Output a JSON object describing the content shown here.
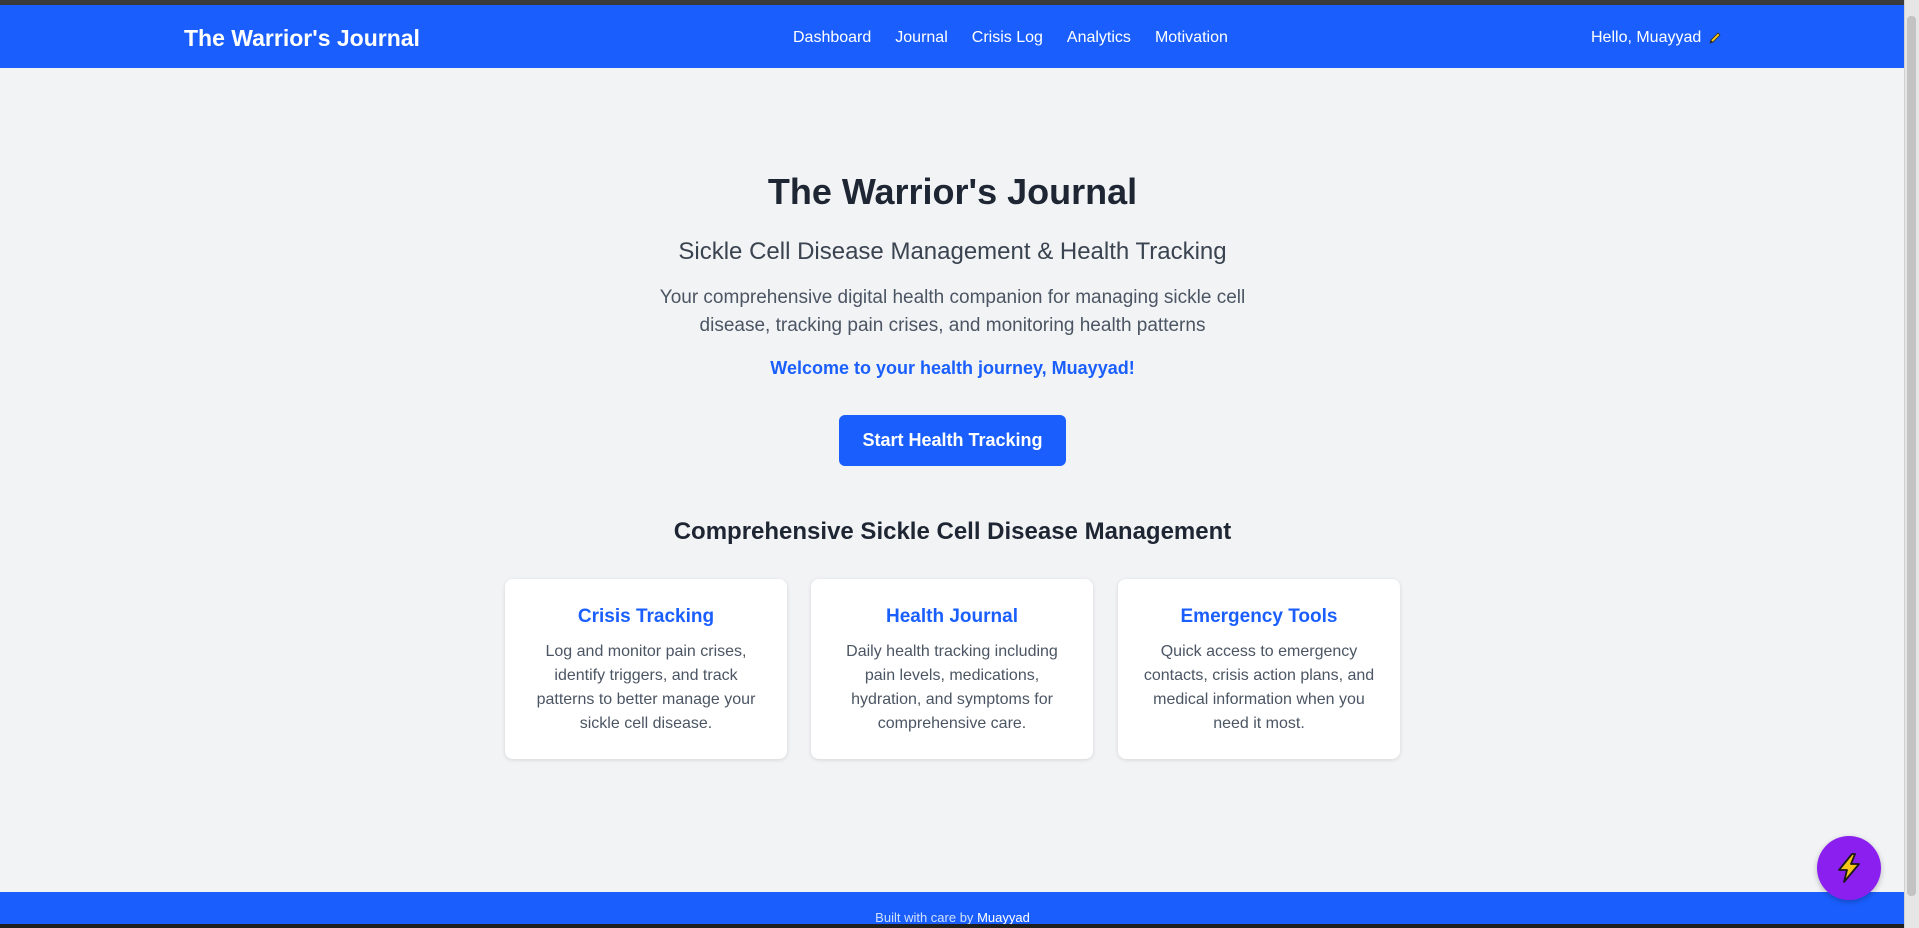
{
  "nav": {
    "brand": "The Warrior's Journal",
    "links": [
      "Dashboard",
      "Journal",
      "Crisis Log",
      "Analytics",
      "Motivation"
    ],
    "greeting": "Hello, Muayyad",
    "greeting_icon": "pencil-icon"
  },
  "hero": {
    "title": "The Warrior's Journal",
    "subtitle": "Sickle Cell Disease Management & Health Tracking",
    "description_line1": "Your comprehensive digital health companion for managing sickle cell",
    "description_line2": "disease, tracking pain crises, and monitoring health patterns",
    "welcome": "Welcome to your health journey, Muayyad!",
    "cta_label": "Start Health Tracking"
  },
  "features": {
    "title": "Comprehensive Sickle Cell Disease Management",
    "cards": [
      {
        "title": "Crisis Tracking",
        "lines": [
          "Log and monitor pain crises,",
          "identify triggers, and track",
          "patterns to better manage your",
          "sickle cell disease."
        ]
      },
      {
        "title": "Health Journal",
        "lines": [
          "Daily health tracking including",
          "pain levels, medications,",
          "hydration, and symptoms for",
          "comprehensive care."
        ]
      },
      {
        "title": "Emergency Tools",
        "lines": [
          "Quick access to emergency",
          "contacts, crisis action plans, and",
          "medical information when you",
          "need it most."
        ]
      }
    ]
  },
  "footer": {
    "prefix": "Built with care by",
    "author": "Muayyad"
  },
  "fab": {
    "icon": "lightning-icon"
  },
  "colors": {
    "primary": "#1a5ffe",
    "background": "#f2f3f5",
    "fab": "#8b1ff0",
    "lightning": "#f5c518"
  }
}
